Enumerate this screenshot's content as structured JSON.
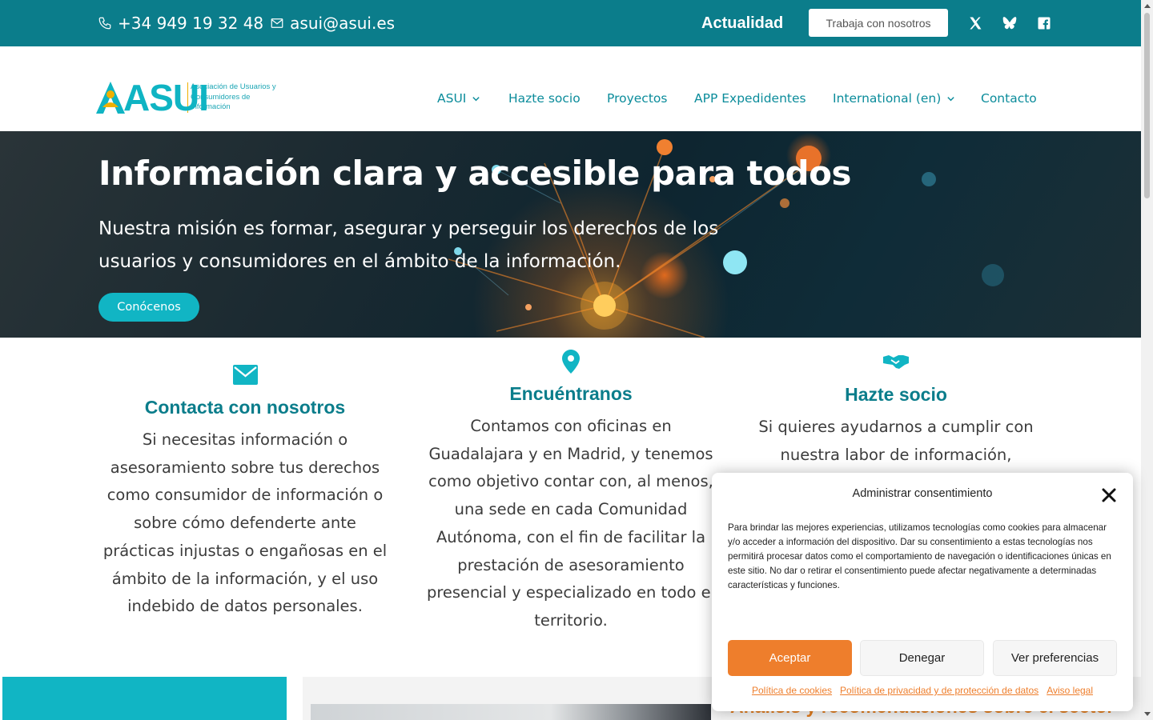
{
  "topbar": {
    "phone": "+34 949 19 32 48",
    "email": "asui@asui.es",
    "news_link": "Actualidad",
    "jobs_button": "Trabaja con nosotros",
    "social": [
      "x-icon",
      "bluesky-icon",
      "facebook-icon"
    ]
  },
  "header": {
    "logo_text": "ASUI",
    "logo_sub": "Asociación de Usuarios y Consumidores de Información",
    "nav": [
      {
        "label": "ASUI",
        "has_dropdown": true
      },
      {
        "label": "Hazte socio",
        "has_dropdown": false
      },
      {
        "label": "Proyectos",
        "has_dropdown": false
      },
      {
        "label": "APP Expedidentes",
        "has_dropdown": false
      },
      {
        "label": "International (en)",
        "has_dropdown": true
      },
      {
        "label": "Contacto",
        "has_dropdown": false
      }
    ]
  },
  "hero": {
    "title": "Información clara y accesible para todos",
    "subtitle": "Nuestra misión es formar, asegurar y perseguir los derechos de los usuarios y consumidores en el ámbito de la información.",
    "cta": "Conócenos"
  },
  "features": [
    {
      "icon": "envelope-icon",
      "title": "Contacta con nosotros",
      "text": "Si necesitas información o asesoramiento sobre tus derechos como consumidor de información o sobre cómo defenderte ante prácticas injustas o engañosas en el ámbito de la información, y el uso indebido de datos personales."
    },
    {
      "icon": "map-pin-icon",
      "title": "Encuéntranos",
      "text": "Contamos con oficinas en Guadalajara y en Madrid, y tenemos como objetivo contar con, al menos, una sede en cada Comunidad Autónoma, con el fin de facilitar la prestación de asesoramiento presencial y especializado en todo el territorio."
    },
    {
      "icon": "handshake-icon",
      "title": "Hazte socio",
      "text": "Si quieres ayudarnos a cumplir con nuestra labor de información,"
    }
  ],
  "bottom": {
    "analysis_title": "Análisis y recomendaciones sobre el sector"
  },
  "consent": {
    "title": "Administrar consentimiento",
    "body": "Para brindar las mejores experiencias, utilizamos tecnologías como cookies para almacenar y/o acceder a información del dispositivo. Dar su consentimiento a estas tecnologías nos permitirá procesar datos como el comportamiento de navegación o identificaciones únicas en este sitio. No dar o retirar el consentimiento puede afectar negativamente a determinadas características y funciones.",
    "accept": "Aceptar",
    "deny": "Denegar",
    "preferences": "Ver preferencias",
    "links": [
      "Política de cookies",
      "Política de privacidad y de protección de datos",
      "Aviso legal"
    ]
  },
  "colors": {
    "brand_teal": "#0b7d8b",
    "accent_cyan": "#11b5c4",
    "accent_orange": "#ee7e2c"
  }
}
